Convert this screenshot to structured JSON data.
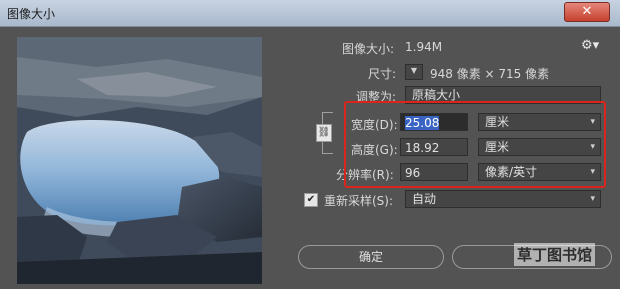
{
  "window": {
    "title": "图像大小",
    "close_glyph": "✕"
  },
  "info": {
    "image_size_label": "图像大小:",
    "image_size_value": "1.94M",
    "gear_icon": "gear-icon",
    "dimensions_label": "尺寸:",
    "dimensions_value": "948 像素 × 715 像素",
    "fit_label": "调整为:",
    "fit_value": "原稿大小"
  },
  "fields": {
    "width_label": "宽度(D):",
    "width_value": "25.08",
    "width_unit": "厘米",
    "height_label": "高度(G):",
    "height_value": "18.92",
    "height_unit": "厘米",
    "resolution_label": "分辨率(R):",
    "resolution_value": "96",
    "resolution_unit": "像素/英寸"
  },
  "resample": {
    "label": "重新采样(S):",
    "checked": true,
    "value": "自动"
  },
  "buttons": {
    "ok": "确定"
  },
  "watermark": "草丁图书馆",
  "colors": {
    "accent_red": "#d8261c",
    "dialog_bg": "#535353",
    "selection": "#3a64c4"
  }
}
